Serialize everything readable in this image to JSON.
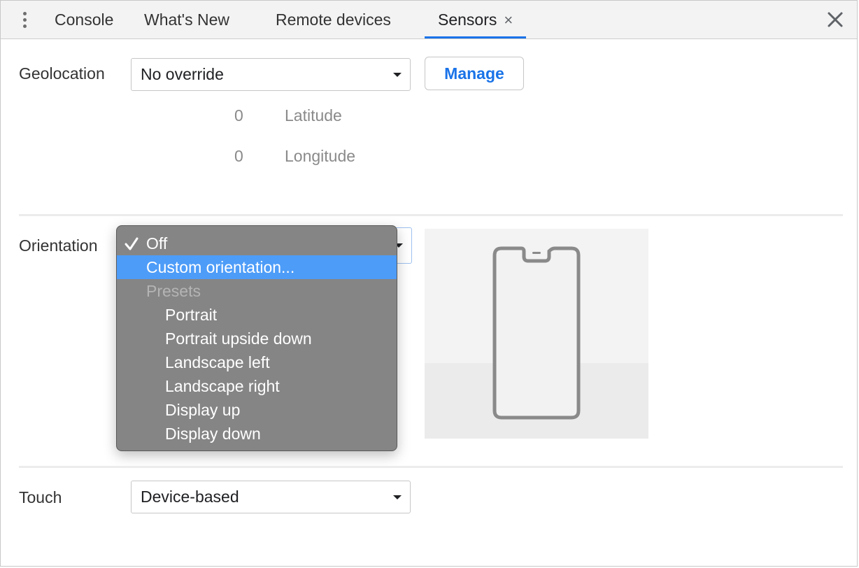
{
  "tabs": {
    "console": "Console",
    "whats_new": "What's New",
    "remote_devices": "Remote devices",
    "sensors": "Sensors",
    "sensors_close": "×"
  },
  "geolocation": {
    "label": "Geolocation",
    "selected": "No override",
    "manage_label": "Manage",
    "latitude_value": "0",
    "latitude_label": "Latitude",
    "longitude_value": "0",
    "longitude_label": "Longitude"
  },
  "orientation": {
    "label": "Orientation",
    "menu": {
      "off": "Off",
      "custom": "Custom orientation...",
      "presets_group": "Presets",
      "portrait": "Portrait",
      "portrait_upside_down": "Portrait upside down",
      "landscape_left": "Landscape left",
      "landscape_right": "Landscape right",
      "display_up": "Display up",
      "display_down": "Display down"
    },
    "checked_option": "Off",
    "highlighted_option": "Custom orientation..."
  },
  "touch": {
    "label": "Touch",
    "selected": "Device-based"
  },
  "colors": {
    "accent": "#1a73e8",
    "menu_background": "#858585",
    "menu_highlight": "#4d9cf8",
    "tabbar_background": "#f3f3f3"
  },
  "icons": {
    "more": "kebab-menu-icon",
    "close_tab": "close-icon",
    "close_panel": "close-icon",
    "checkmark": "checkmark-icon",
    "device": "phone-icon"
  }
}
